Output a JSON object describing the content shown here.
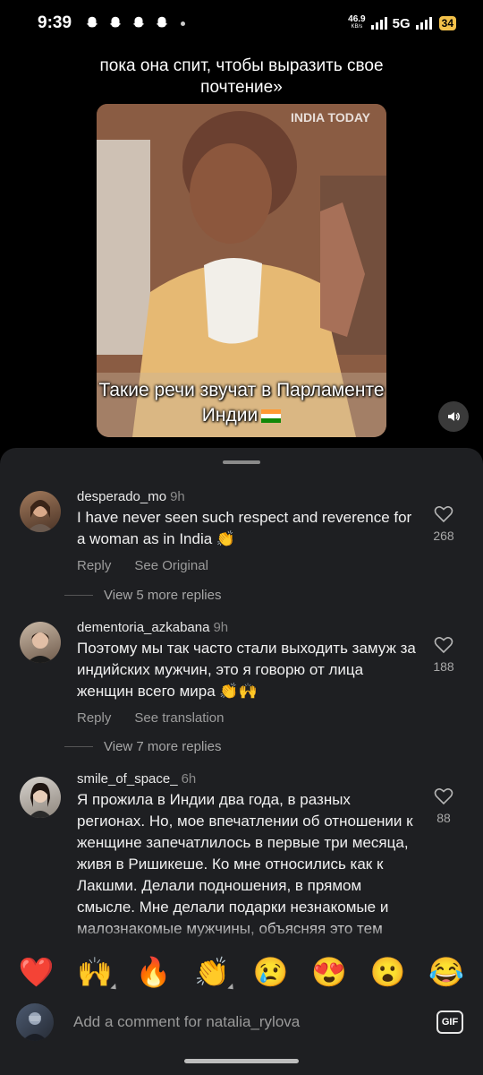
{
  "status_bar": {
    "time": "9:39",
    "data_speed": "46.9",
    "data_unit": "KB/s",
    "network": "5G",
    "battery": "34"
  },
  "video": {
    "top_caption": "пока она спит, чтобы выразить свое почтение»",
    "watermark": "INDIA TODAY",
    "bottom_caption": "Такие речи звучат в Парламенте Индии"
  },
  "comments": [
    {
      "username": "desperado_mo",
      "time_ago": "9h",
      "text": "I have never seen such respect and reverence for a woman as in India 👏",
      "likes": "268",
      "reply_label": "Reply",
      "secondary_label": "See Original",
      "more_replies": "View 5 more replies"
    },
    {
      "username": "dementoria_azkabana",
      "time_ago": "9h",
      "text": "Поэтому мы так часто стали выходить замуж за индийских мужчин, это я говорю от лица женщин всего мира 👏🙌",
      "likes": "188",
      "reply_label": "Reply",
      "secondary_label": "See translation",
      "more_replies": "View 7 more replies"
    },
    {
      "username": "smile_of_space_",
      "time_ago": "6h",
      "text": "Я прожила в Индии два года, в разных регионах. Но, мое впечатлении об отношении к женщине запечатлилось в первые три месяца, живя в Ришикеше. Ко мне относились как к Лакшми. Делали подношения, в прямом смысле. Мне делали подарки незнакомые и малознакомые мужчины, объясняя это тем",
      "likes": "88"
    }
  ],
  "emoji_bar": [
    "❤️",
    "🙌",
    "🔥",
    "👏",
    "😢",
    "😍",
    "😮",
    "😂"
  ],
  "input": {
    "placeholder": "Add a comment for natalia_rylova",
    "gif_label": "GIF"
  }
}
